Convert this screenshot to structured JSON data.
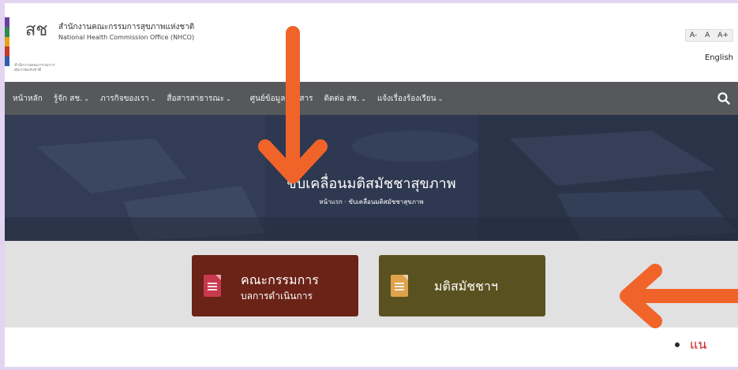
{
  "header": {
    "org_name_th": "สำนักงานคณะกรรมการสุขภาพแห่งชาติ",
    "org_name_en": "National Health Commission Office (NHCO)",
    "logo_caption": "สำนักงานคณะกรรมการสุขภาพแห่งชาติ",
    "font_size_controls": [
      "A-",
      "A",
      "A+"
    ],
    "language": "English"
  },
  "nav": {
    "items": [
      {
        "label": "หน้าหลัก",
        "has_dropdown": false
      },
      {
        "label": "รู้จัก สช.",
        "has_dropdown": true
      },
      {
        "label": "ภารกิจของเรา",
        "has_dropdown": true
      },
      {
        "label": "สื่อสารสาธารณะ",
        "has_dropdown": true
      },
      {
        "label": "ศูนย์ข้อมูลข่าวสาร",
        "has_dropdown": false
      },
      {
        "label": "ติดต่อ สช.",
        "has_dropdown": true
      },
      {
        "label": "แจ้งเรื่องร้องเรียน",
        "has_dropdown": true
      }
    ],
    "search_icon": "search-icon"
  },
  "hero": {
    "title": "ขับเคลื่อนมติสมัชชาสุขภาพ",
    "breadcrumb": "หน้าแรก · ขับเคลื่อนมติสมัชชาสุขภาพ"
  },
  "cards": {
    "committee": {
      "line1": "คณะกรรมการ",
      "line2": "บลการดำเนินการ",
      "color": "#6b2217",
      "icon": "document-list-icon"
    },
    "resolution": {
      "line1": "มติสมัชชาฯ",
      "color": "#5a5120",
      "icon": "document-list-icon"
    }
  },
  "footer": {
    "text": "แน"
  },
  "colors": {
    "nav_bg": "#56585c",
    "annotation_arrow": "#f0642a",
    "frame": "#e3d4f2"
  }
}
